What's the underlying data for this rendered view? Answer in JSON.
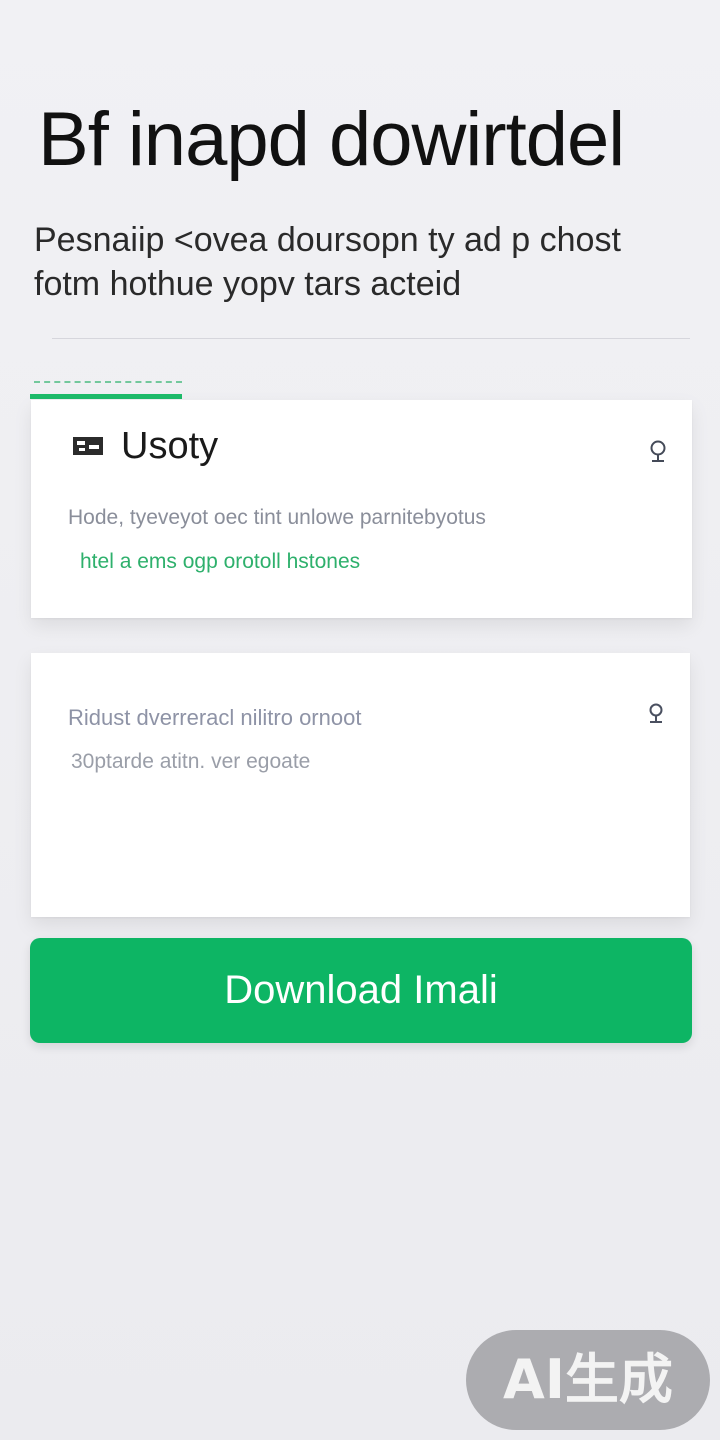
{
  "header": {
    "title": "Bf inapd dowirtdel",
    "subtitle": "Pesnaiip <ovea doursopn ty ad p chost fotm hothue yopv tars acteid"
  },
  "cards": [
    {
      "title": "Usoty",
      "description": "Hode, tyeveyot oec tint unlowe parnitebyotus",
      "link": "htel a ems ogp orotoll hstones"
    },
    {
      "description": "Ridust dverreracl nilitro ornoot",
      "subtext": "30ptarde atitn. ver egoate"
    }
  ],
  "actions": {
    "download_label": "Download Imali"
  },
  "badge": {
    "label": "AI生成"
  },
  "colors": {
    "accent": "#0db564",
    "link": "#2eb06c",
    "background": "#ececf0"
  }
}
